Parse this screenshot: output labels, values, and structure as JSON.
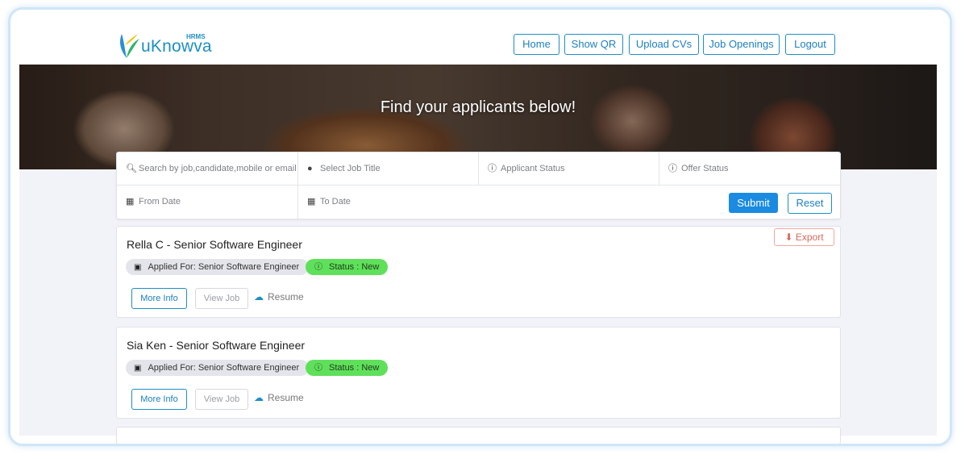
{
  "brand": {
    "name": "uKnowva",
    "tag": "HRMS",
    "color": "#1d8fc4"
  },
  "nav": [
    "Home",
    "Show QR",
    "Upload CVs",
    "Job Openings",
    "Logout"
  ],
  "hero": {
    "title": "Find your applicants below!"
  },
  "filters": {
    "search_placeholder": "Search by job,candidate,mobile or email",
    "job_title_placeholder": "Select Job Title",
    "applicant_status_placeholder": "Applicant Status",
    "offer_status_placeholder": "Offer Status",
    "from_date_placeholder": "From Date",
    "to_date_placeholder": "To Date",
    "submit_label": "Submit",
    "reset_label": "Reset"
  },
  "export_label": "Export",
  "applicants": [
    {
      "name": "Rella C - Senior Software Engineer",
      "applied_for": "Applied For: Senior Software Engineer",
      "status": "Status : New",
      "more_info": "More Info",
      "view_job": "View Job",
      "resume": "Resume"
    },
    {
      "name": "Sia Ken - Senior Software Engineer",
      "applied_for": "Applied For: Senior Software Engineer",
      "status": "Status : New",
      "more_info": "More Info",
      "view_job": "View Job",
      "resume": "Resume"
    }
  ],
  "colors": {
    "accent": "#1a8be0",
    "status_new": "#5fe05a",
    "export": "#d9695e"
  }
}
